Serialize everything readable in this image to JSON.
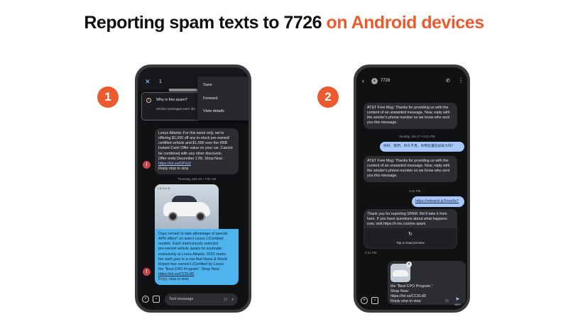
{
  "headline": {
    "lead": "Reporting spam texts to 7726",
    "accent": "on Android devices"
  },
  "colors": {
    "accent": "#ec5b2f",
    "screen_bg": "#101113",
    "incoming_bubble": "#2b2d31",
    "outgoing_bubble": "#a8c7fa",
    "selected_bubble": "#4fb3ee"
  },
  "steps": [
    "1",
    "2"
  ],
  "phone1": {
    "top_bar": {
      "close_icon": "close-icon",
      "number": "1"
    },
    "spam_card": {
      "title": "Why is this spam?",
      "subtitle": "Similar messages were ide"
    },
    "overflow_menu": [
      "Save",
      "Forward",
      "View details"
    ],
    "message1": {
      "lines": [
        "Lexus Atlanta: For this week only, we're",
        "offering $1,000 off any in-stock pre-owned/",
        "certified vehicle and $1,000 over the KBB",
        "Instant Cash Offer value on your car. Cannot",
        "be combined with any other discounts.",
        "Offer ends December 17th. Shop Now:",
        "https://txt.so/DP3z0",
        "Reply stop to stop"
      ]
    },
    "date_divider": "Thursday, Mar 20 • 7:04 AM",
    "message2": {
      "image_brand": "LEXUS",
      "lines": [
        "Days remain to take advantage of special",
        "APR offers* on select Lexus L/Certified",
        "models. Each meticulously selected",
        "pre-owned vehicle awaits its soulmate,",
        "exclusively at Lexus Atlanta. 2023 marks",
        "the sixth year in a row that News & World",
        "Report has named L/Certified by Lexus",
        "the \"Best CPO Program.\" Shop Now:",
        "https://txt.so/CC5LdD",
        "Reply stop to stop"
      ],
      "time": "7:04 AM"
    },
    "compose": {
      "placeholder": "Text message"
    }
  },
  "phone2": {
    "top_bar": {
      "contact": "7726"
    },
    "msg1": {
      "lines": [
        "AT&T Free Msg: Thanks for providing us with the",
        "content of an unwanted message. Now, reply with",
        "the sender's phone number so we know who sent",
        "you this message."
      ]
    },
    "time1": "Sunday, Jan 17 • 8:21 PM",
    "out1": "你好，我們，好久不見，你現在還在加拿大吗？",
    "msg2": {
      "lines": [
        "AT&T Free Msg: Thanks for providing us with the",
        "content of an unwanted message. Now, reply with",
        "the sender's phone number so we know who sent",
        "you this message."
      ]
    },
    "time2": "2:41 PM",
    "out2": "https://rebrand.ly/5oxe9e7",
    "msg3": {
      "lines": [
        "Thank you for reporting SPAM. We'll take it from",
        "here. If you have questions about what happens",
        "now, visit https://t-mo.co/sms-spam"
      ]
    },
    "preview_label": "Tap to load preview",
    "time3": "2:41 PM",
    "attachment": {
      "lines": [
        "the \"Best CPO Program.\"",
        "Shop Now:",
        "https://txt.so/CC5LdD",
        "Reply stop to stop"
      ]
    },
    "send_label": "MMS"
  }
}
